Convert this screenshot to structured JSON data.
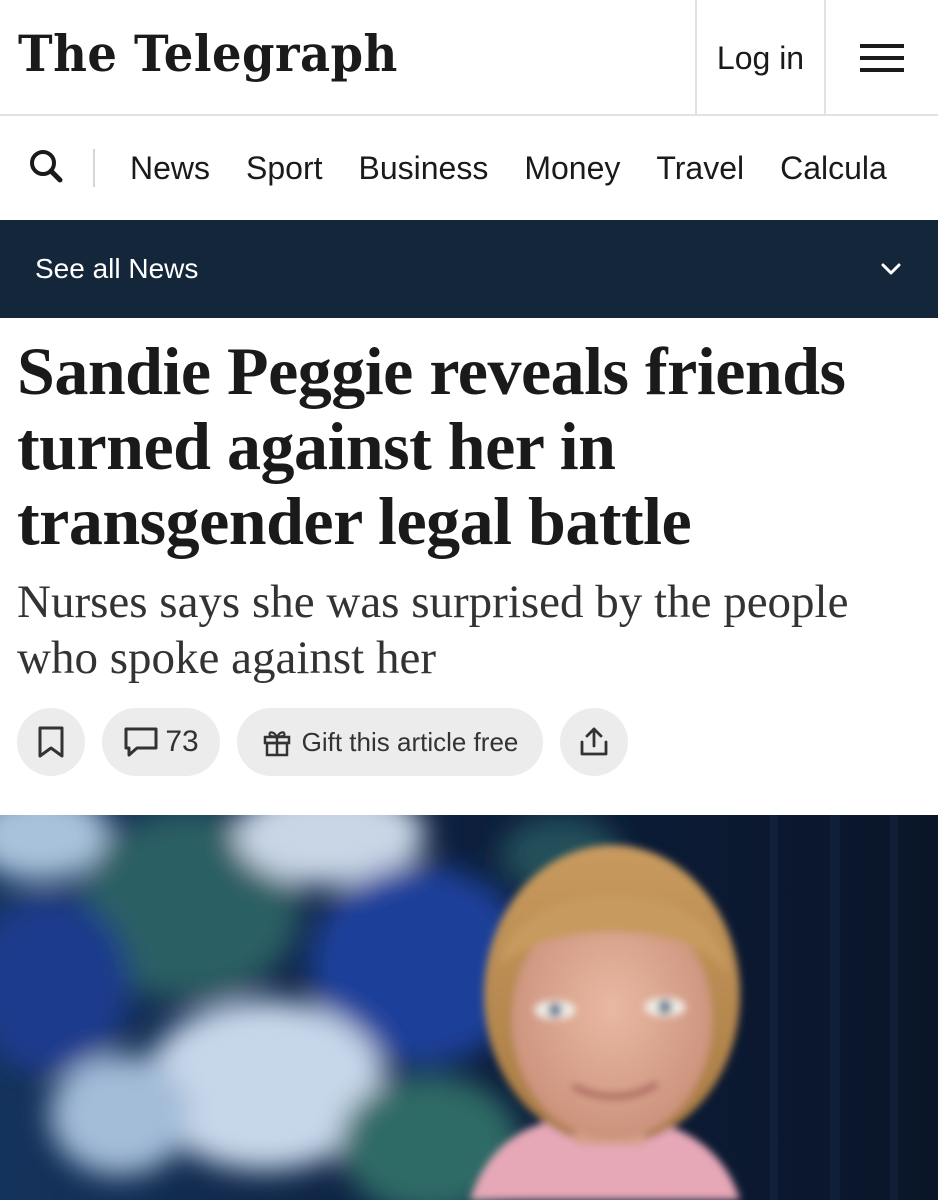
{
  "header": {
    "logo": "The Telegraph",
    "login_label": "Log in",
    "menu_icon": "hamburger-menu-icon"
  },
  "nav": {
    "search_icon": "search-icon",
    "items": [
      {
        "label": "News"
      },
      {
        "label": "Sport"
      },
      {
        "label": "Business"
      },
      {
        "label": "Money"
      },
      {
        "label": "Travel"
      },
      {
        "label": "Calcula"
      }
    ]
  },
  "section": {
    "label": "See all News",
    "icon": "chevron-down-icon"
  },
  "article": {
    "headline": "Sandie Peggie reveals friends turned against her in transgender legal battle",
    "standfirst": "Nurses says she was surprised by the people who spoke against her",
    "actions": {
      "bookmark_icon": "bookmark-icon",
      "comment_icon": "comment-icon",
      "comment_count": "73",
      "gift_icon": "gift-icon",
      "gift_label": "Gift this article free",
      "share_icon": "share-icon"
    }
  },
  "colors": {
    "section_bar": "#14273a",
    "pill_background": "#ececec",
    "text": "#1a1a1a"
  }
}
